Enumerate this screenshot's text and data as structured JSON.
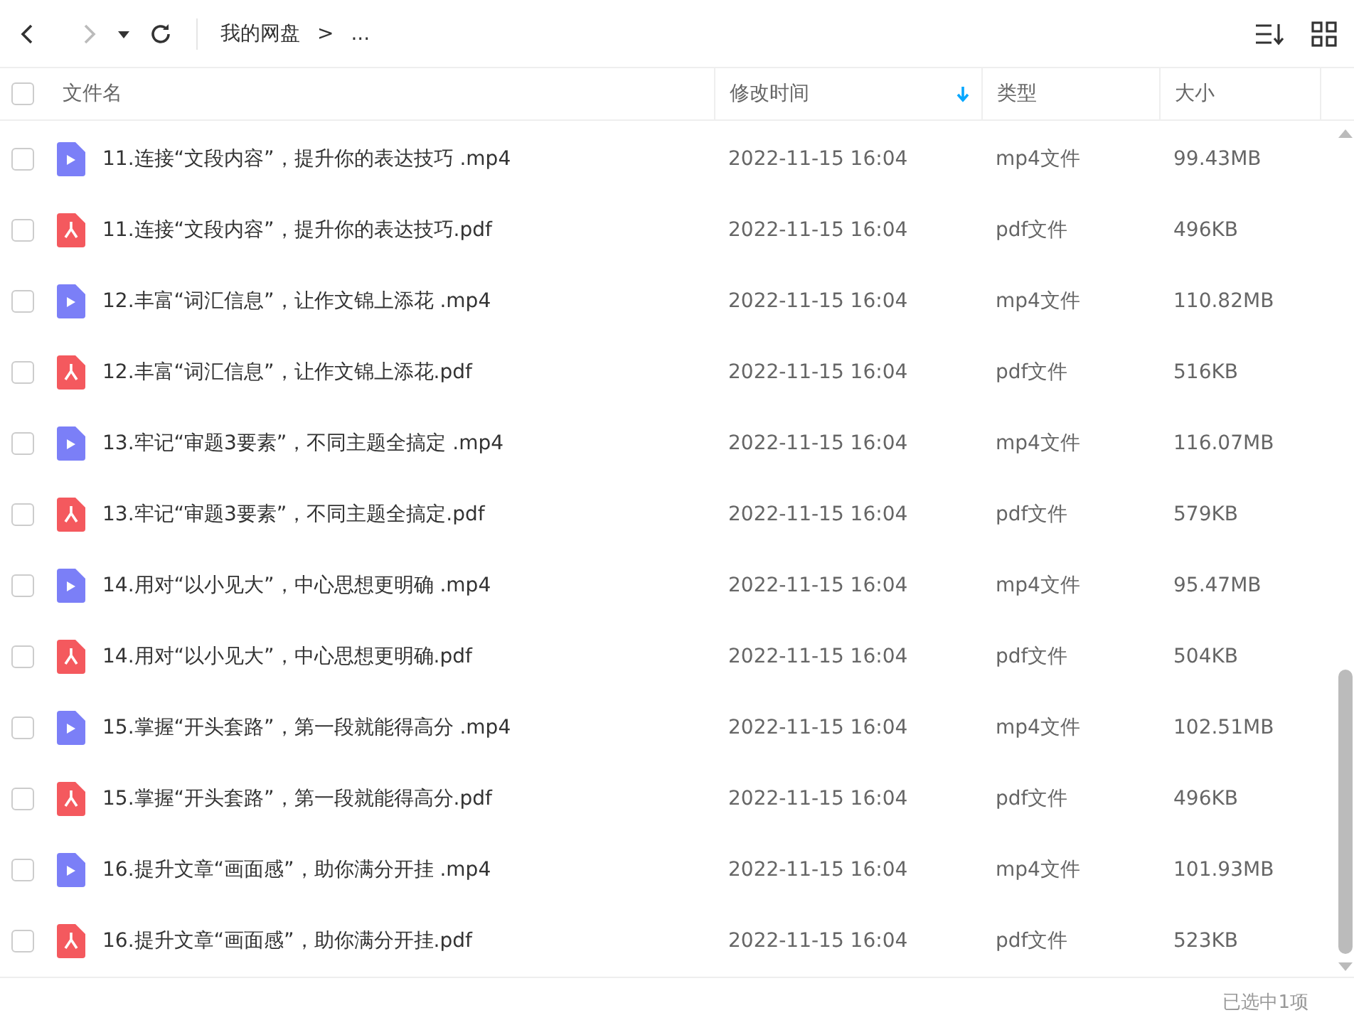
{
  "toolbar": {
    "breadcrumb": [
      {
        "label": "我的网盘"
      },
      {
        "label": "..."
      }
    ],
    "separator": ">"
  },
  "table": {
    "columns": [
      {
        "label": "文件名",
        "sorted": false
      },
      {
        "label": "修改时间",
        "sorted": true
      },
      {
        "label": "类型",
        "sorted": false
      },
      {
        "label": "大小",
        "sorted": false
      }
    ],
    "all_checked": false,
    "rows": [
      {
        "kind": "video",
        "name": "11.连接“文段内容”，提升你的表达技巧 .mp4",
        "modified": "2022-11-15 16:04",
        "type": "mp4文件",
        "size": "99.43MB",
        "selected": false
      },
      {
        "kind": "pdf",
        "name": "11.连接“文段内容”，提升你的表达技巧.pdf",
        "modified": "2022-11-15 16:04",
        "type": "pdf文件",
        "size": "496KB",
        "selected": false
      },
      {
        "kind": "video",
        "name": "12.丰富“词汇信息”，让作文锦上添花 .mp4",
        "modified": "2022-11-15 16:04",
        "type": "mp4文件",
        "size": "110.82MB",
        "selected": false
      },
      {
        "kind": "pdf",
        "name": "12.丰富“词汇信息”，让作文锦上添花.pdf",
        "modified": "2022-11-15 16:04",
        "type": "pdf文件",
        "size": "516KB",
        "selected": false
      },
      {
        "kind": "video",
        "name": "13.牢记“审题3要素”，不同主题全搞定 .mp4",
        "modified": "2022-11-15 16:04",
        "type": "mp4文件",
        "size": "116.07MB",
        "selected": false
      },
      {
        "kind": "pdf",
        "name": "13.牢记“审题3要素”，不同主题全搞定.pdf",
        "modified": "2022-11-15 16:04",
        "type": "pdf文件",
        "size": "579KB",
        "selected": false
      },
      {
        "kind": "video",
        "name": "14.用对“以小见大”，中心思想更明确 .mp4",
        "modified": "2022-11-15 16:04",
        "type": "mp4文件",
        "size": "95.47MB",
        "selected": false
      },
      {
        "kind": "pdf",
        "name": "14.用对“以小见大”，中心思想更明确.pdf",
        "modified": "2022-11-15 16:04",
        "type": "pdf文件",
        "size": "504KB",
        "selected": false
      },
      {
        "kind": "video",
        "name": "15.掌握“开头套路”，第一段就能得高分 .mp4",
        "modified": "2022-11-15 16:04",
        "type": "mp4文件",
        "size": "102.51MB",
        "selected": false
      },
      {
        "kind": "pdf",
        "name": "15.掌握“开头套路”，第一段就能得高分.pdf",
        "modified": "2022-11-15 16:04",
        "type": "pdf文件",
        "size": "496KB",
        "selected": false
      },
      {
        "kind": "video",
        "name": "16.提升文章“画面感”，助你满分开挂 .mp4",
        "modified": "2022-11-15 16:04",
        "type": "mp4文件",
        "size": "101.93MB",
        "selected": false
      },
      {
        "kind": "pdf",
        "name": "16.提升文章“画面感”，助你满分开挂.pdf",
        "modified": "2022-11-15 16:04",
        "type": "pdf文件",
        "size": "523KB",
        "selected": false
      }
    ]
  },
  "status_bar": {
    "text": "已选中1项"
  }
}
